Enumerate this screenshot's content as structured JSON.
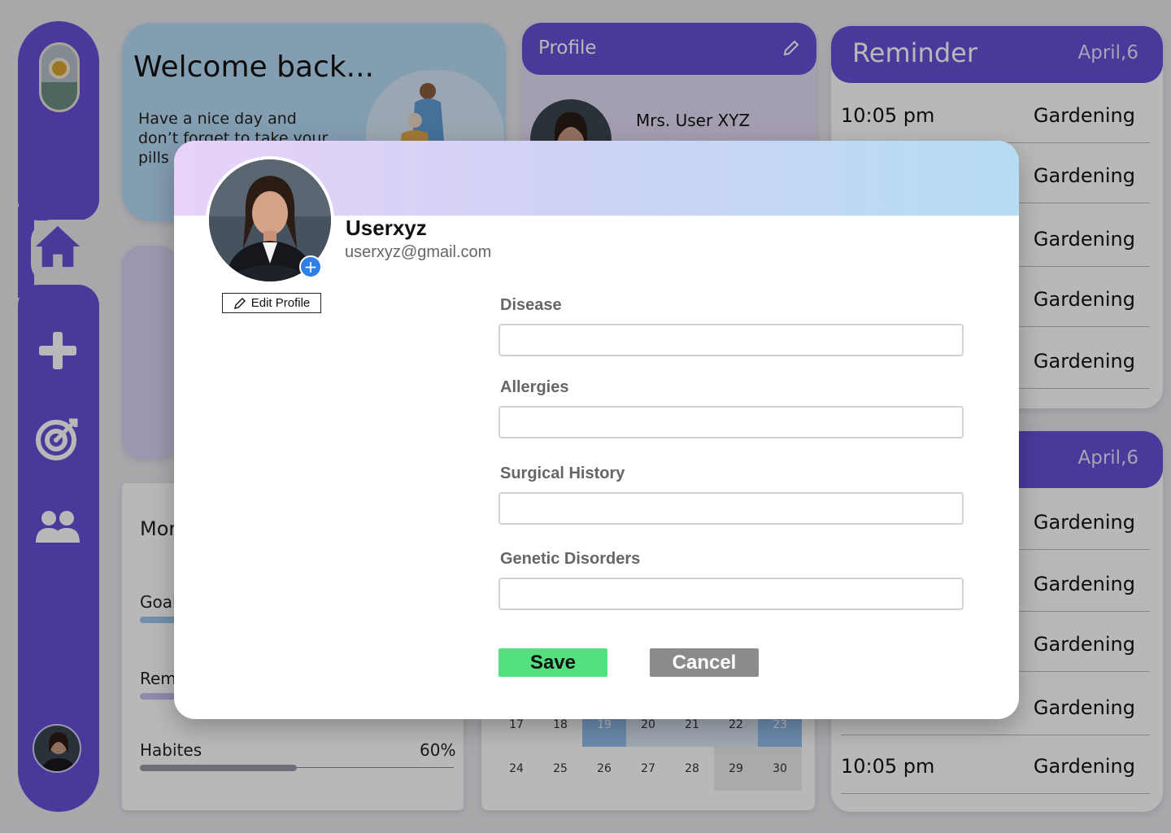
{
  "colors": {
    "brand_purple": "#6750d6",
    "save_green": "#55e07f",
    "cancel_grey": "#8b8b8b",
    "badge_blue": "#2f7fe6",
    "banner_gradient": [
      "#e8d2f8",
      "#cdd3f4",
      "#b5dcf3"
    ]
  },
  "sidebar": {
    "logo_icon": "pill-sun-logo-icon",
    "items": [
      {
        "icon": "home-icon",
        "active": true
      },
      {
        "icon": "plus-icon"
      },
      {
        "icon": "target-icon"
      },
      {
        "icon": "users-icon"
      }
    ],
    "avatar": "user-avatar"
  },
  "welcome": {
    "title": "Welcome back...",
    "message": "Have a nice day and don’t forget to take your pills"
  },
  "progress_card": {
    "title_partial": "Mor",
    "rows": [
      {
        "label_partial": "Goal",
        "value": 0.45
      },
      {
        "label_partial": "Rem",
        "value": 0.3
      },
      {
        "label": "Habites",
        "percent": "60%",
        "value": 0.5
      }
    ]
  },
  "profile_card": {
    "title": "Profile",
    "name": "Mrs. User XYZ"
  },
  "calendar": {
    "rows": [
      [
        "17",
        "18",
        "19",
        "20",
        "21",
        "22",
        "23"
      ],
      [
        "24",
        "25",
        "26",
        "27",
        "28",
        "29",
        "30"
      ]
    ],
    "highlighted": [
      "19",
      "23"
    ],
    "soft": [
      "20",
      "21",
      "22"
    ],
    "grey": [
      "29",
      "30"
    ]
  },
  "reminders": [
    {
      "title": "Reminder",
      "date": "April,6",
      "items": [
        {
          "time": "10:05 pm",
          "activity": "Gardening"
        },
        {
          "time": "",
          "activity": "Gardening"
        },
        {
          "time": "",
          "activity": "Gardening"
        },
        {
          "time": "",
          "activity": "Gardening"
        },
        {
          "time": "",
          "activity": "Gardening"
        }
      ]
    },
    {
      "title": "",
      "date": "April,6",
      "items": [
        {
          "time": "",
          "activity": "Gardening"
        },
        {
          "time": "",
          "activity": "Gardening"
        },
        {
          "time": "",
          "activity": "Gardening"
        },
        {
          "time": "",
          "activity": "Gardening"
        },
        {
          "time": "10:05 pm",
          "activity": "Gardening"
        }
      ]
    }
  ],
  "modal": {
    "username": "Userxyz",
    "email": "userxyz@gmail.com",
    "edit_profile_label": "Edit Profile",
    "fields": [
      {
        "label": "Disease",
        "value": ""
      },
      {
        "label": "Allergies",
        "value": ""
      },
      {
        "label": "Surgical History",
        "value": ""
      },
      {
        "label": "Genetic Disorders",
        "value": ""
      }
    ],
    "save_label": "Save",
    "cancel_label": "Cancel"
  }
}
